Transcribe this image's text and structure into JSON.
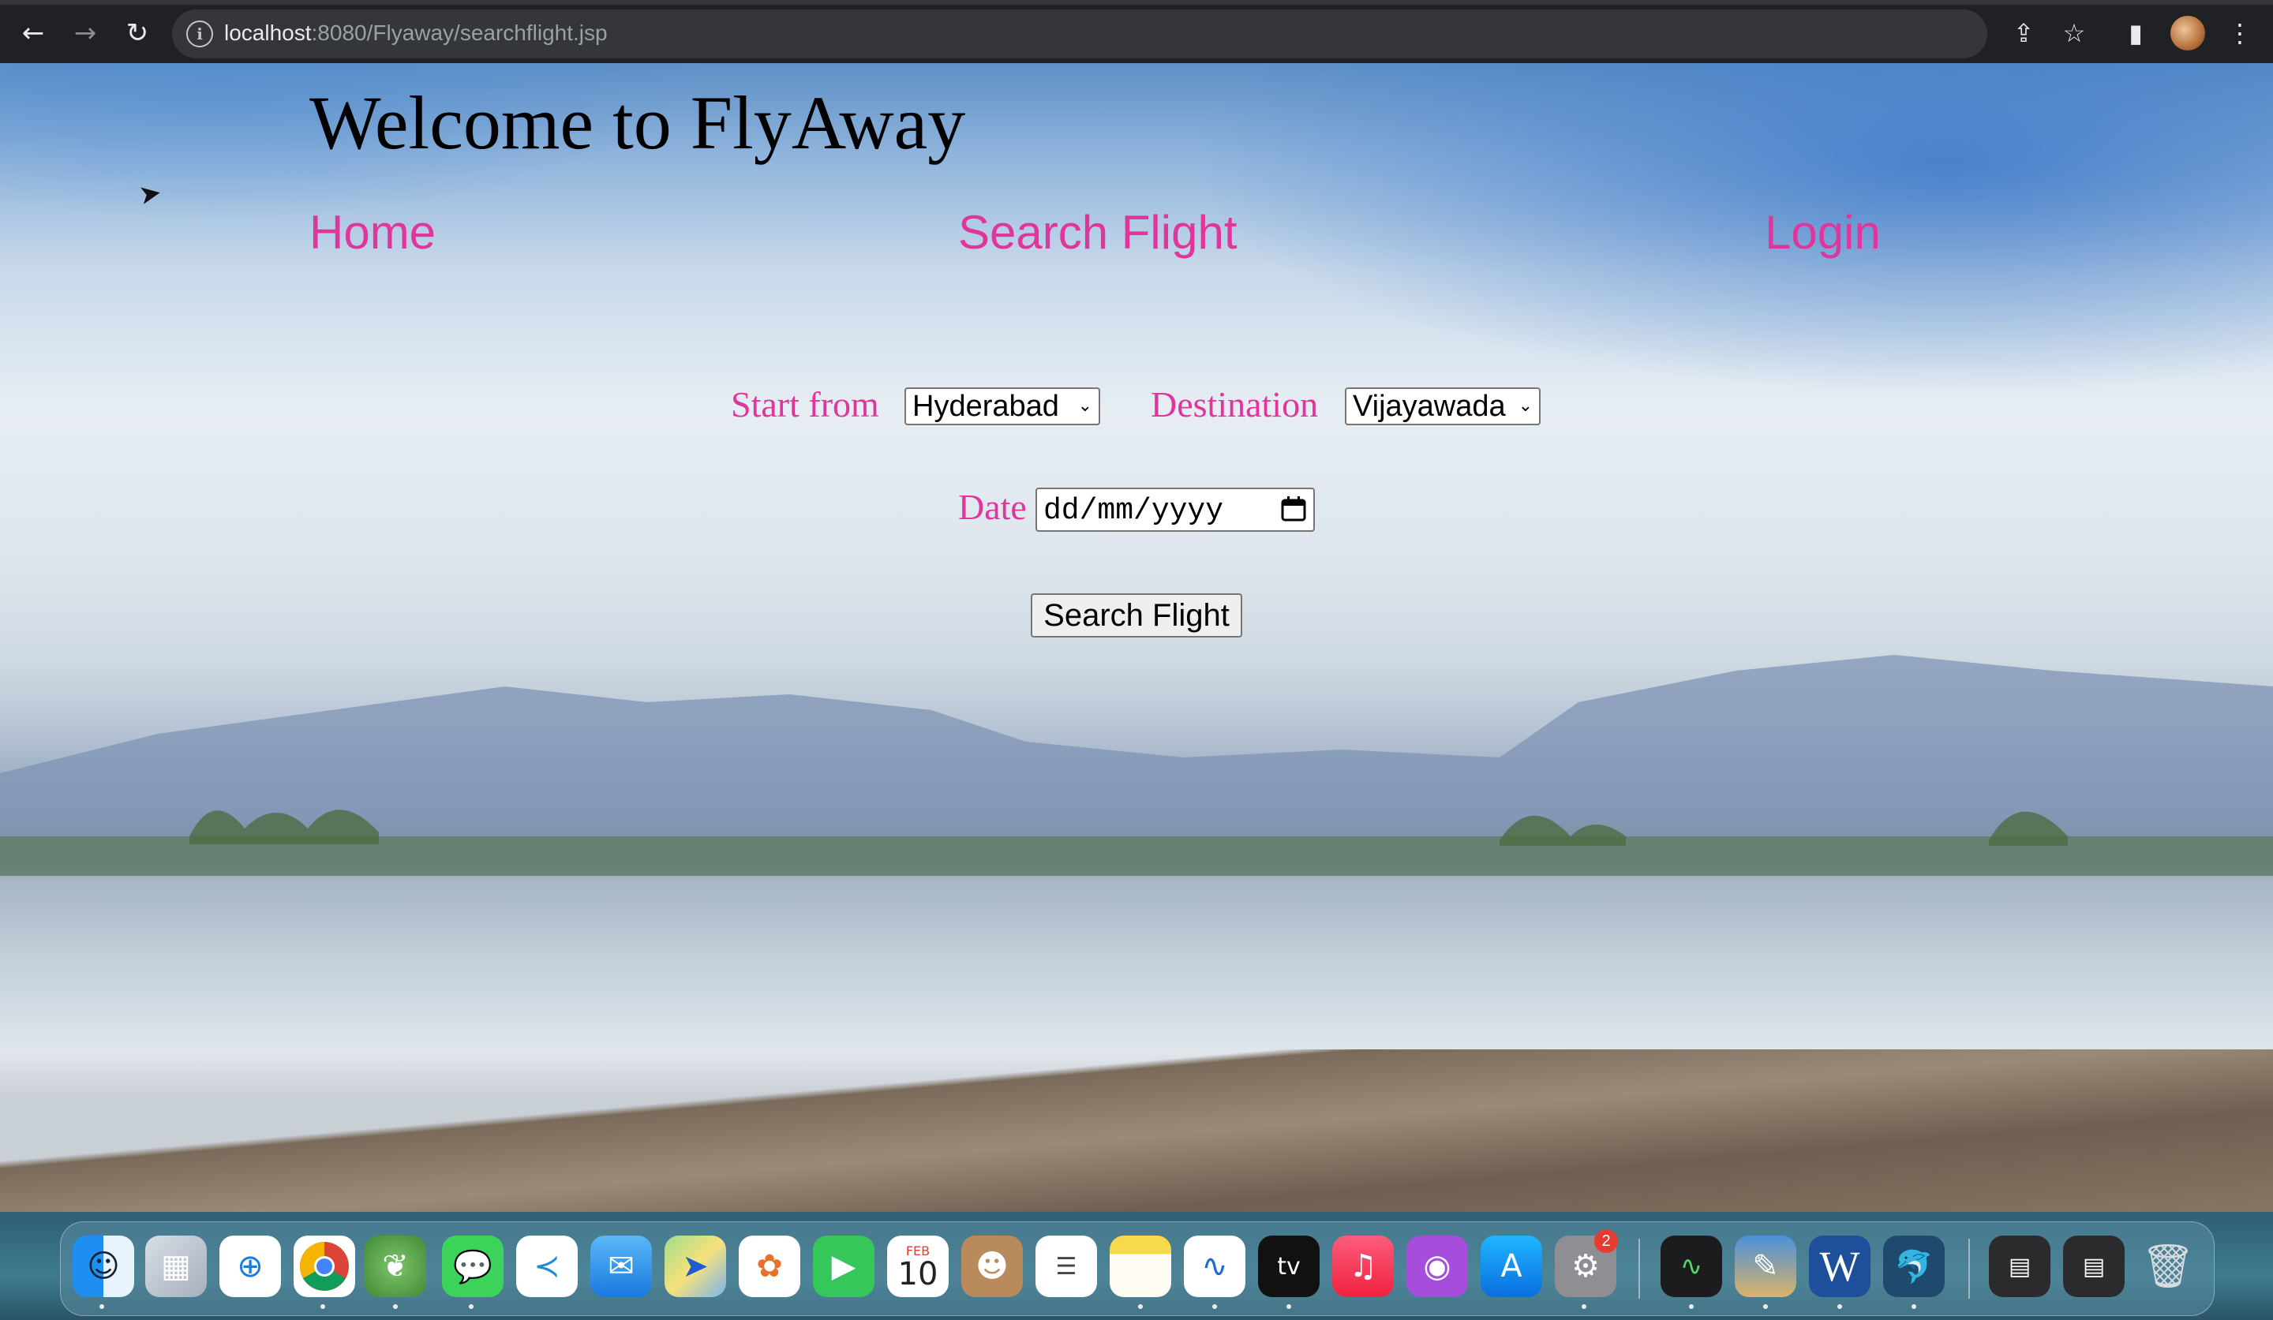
{
  "browser": {
    "url_host": "localhost",
    "url_rest": ":8080/Flyaway/searchflight.jsp"
  },
  "page": {
    "title": "Welcome to FlyAway",
    "nav": {
      "home": "Home",
      "search_flight": "Search Flight",
      "login": "Login"
    },
    "form": {
      "start_label": "Start from",
      "start_value": "Hyderabad",
      "destination_label": "Destination",
      "destination_value": "Vijayawada",
      "date_label": "Date",
      "date_placeholder": "dd/mm/yyyy",
      "submit_label": "Search Flight"
    }
  },
  "dock": {
    "calendar_month": "FEB",
    "calendar_day": "10",
    "appletv_label": "tv",
    "word_letter": "W",
    "settings_badge": "2"
  },
  "colors": {
    "link": "#e0359a",
    "chrome_bg": "#202124"
  }
}
